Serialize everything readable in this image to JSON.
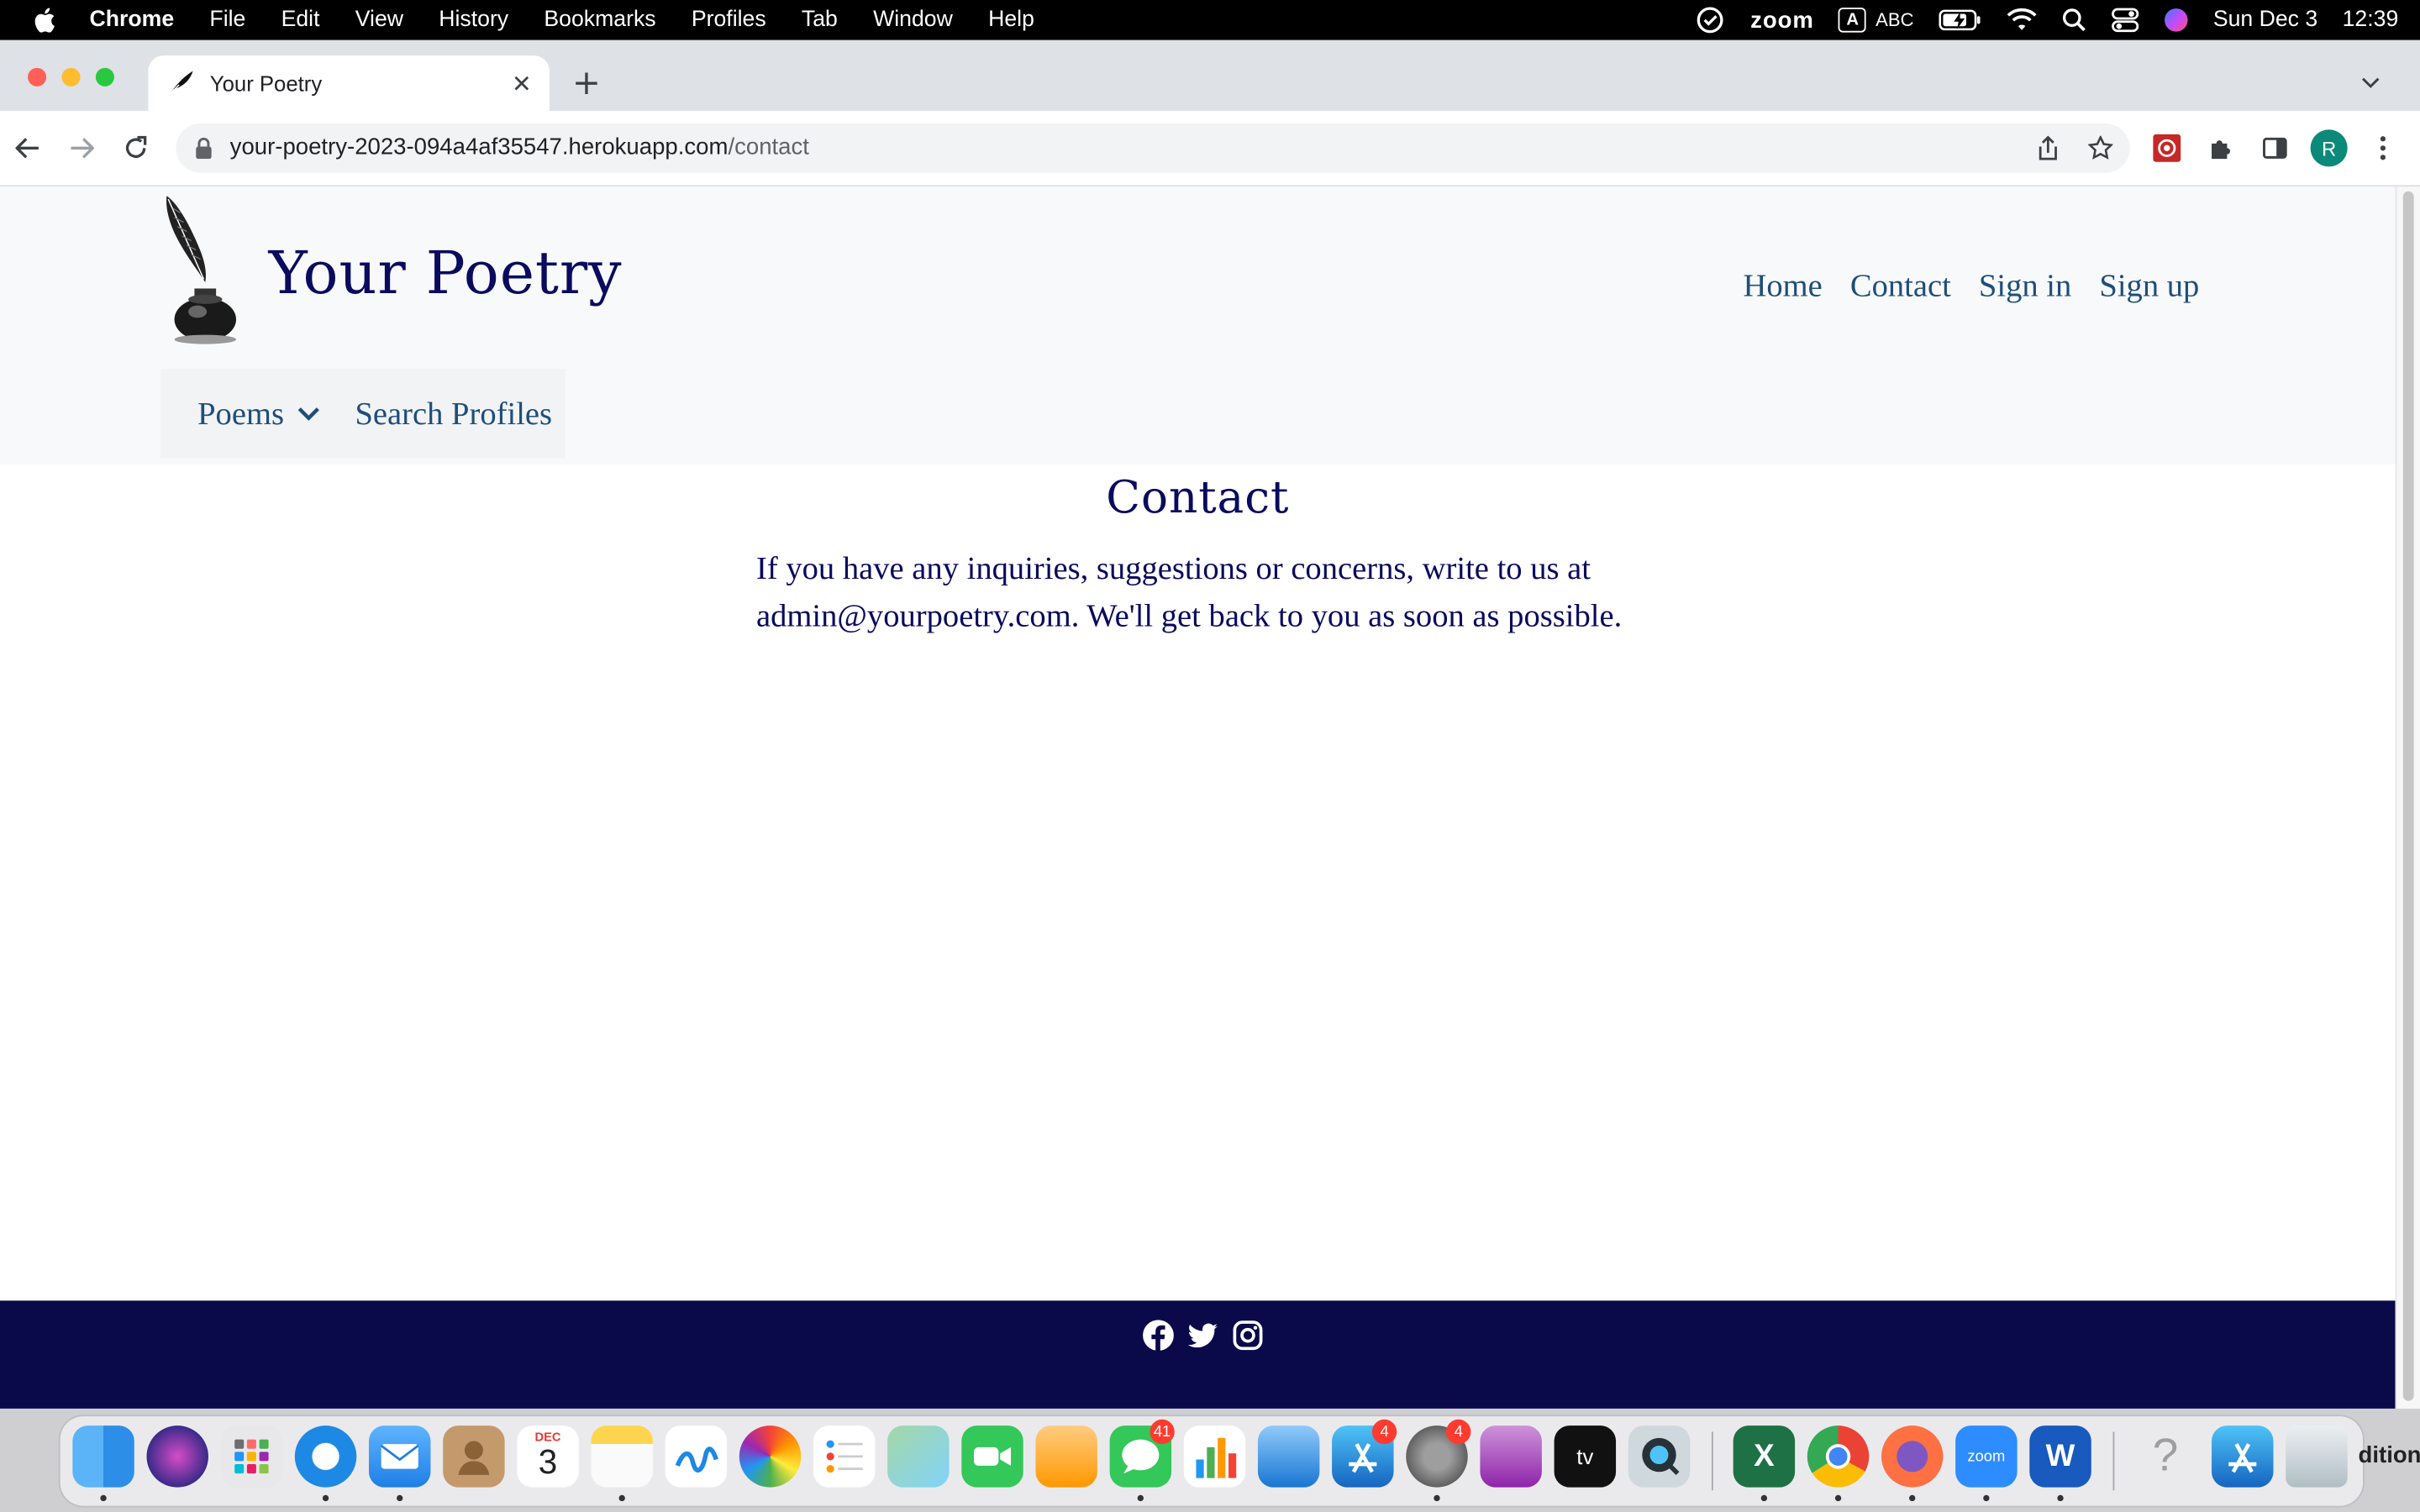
{
  "menubar": {
    "app": "Chrome",
    "items": [
      "File",
      "Edit",
      "View",
      "History",
      "Bookmarks",
      "Profiles",
      "Tab",
      "Window",
      "Help"
    ],
    "zoom": "zoom",
    "input_source_letter": "A",
    "input_source": "ABC",
    "date": "Sun Dec 3",
    "time": "12:39"
  },
  "browser": {
    "tab_title": "Your Poetry",
    "url_host": "your-poetry-2023-094a4af35547.herokuapp.com",
    "url_path": "/contact",
    "profile_initial": "R"
  },
  "site": {
    "brand": "Your Poetry",
    "nav": [
      "Home",
      "Contact",
      "Sign in",
      "Sign up"
    ],
    "subnav": {
      "poems": "Poems",
      "search_profiles": "Search Profiles"
    },
    "contact": {
      "title": "Contact",
      "line1": "If you have any inquiries, suggestions or concerns, write to us at",
      "line2": "admin@yourpoetry.com. We'll get back to you as soon as possible."
    },
    "footer_social": [
      "facebook-icon",
      "twitter-icon",
      "instagram-icon"
    ]
  },
  "dock": {
    "calendar_month": "DEC",
    "calendar_day": "3",
    "messages_badge": "41",
    "appstore_badge": "4",
    "settings_badge": "4",
    "tv_label": "tv",
    "zoom_label": "zoom",
    "right_edge_text": "ditions"
  },
  "colors": {
    "brand_navy": "#0a0a5e",
    "link_blue": "#1f4e79",
    "footer_bg": "#0a0a4a",
    "header_bg": "#f8f9fa"
  }
}
